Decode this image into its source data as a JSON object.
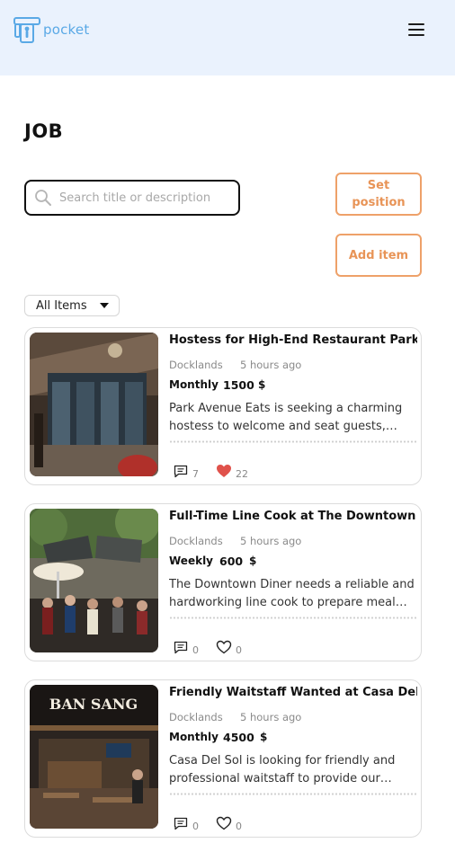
{
  "header": {
    "logo_text": "pocket"
  },
  "page": {
    "title": "JOB"
  },
  "search": {
    "placeholder": "Search title or description"
  },
  "buttons": {
    "set_position_line1": "Set",
    "set_position_line2": "position",
    "add_item": "Add item"
  },
  "filter": {
    "selected": "All Items"
  },
  "colors": {
    "accent": "#eea169",
    "header_bg": "#eaf2fd",
    "logo": "#5aa9e6",
    "liked_heart": "#e0524b"
  },
  "jobs": [
    {
      "title": "Hostess for High-End Restaurant Park",
      "location": "Docklands",
      "time": "5 hours ago",
      "period": "Monthly",
      "price": "1500",
      "currency": "$",
      "description": "Park Avenue Eats is seeking a charming hostess to welcome and seat guests,…",
      "comments": "7",
      "likes": "22",
      "liked": true
    },
    {
      "title": "Full-Time Line Cook at The Downtown",
      "location": "Docklands",
      "time": "5 hours ago",
      "period": "Weekly",
      "price": "600",
      "currency": "$",
      "description": "The Downtown Diner needs a reliable and hardworking line cook to prepare meal…",
      "comments": "0",
      "likes": "0",
      "liked": false
    },
    {
      "title": "Friendly Waitstaff Wanted at Casa Del",
      "location": "Docklands",
      "time": "5 hours ago",
      "period": "Monthly",
      "price": "4500",
      "currency": "$",
      "description": "Casa Del Sol is looking for friendly and professional waitstaff to provide our…",
      "comments": "0",
      "likes": "0",
      "liked": false,
      "image_sign_text": "BAN SANG"
    }
  ]
}
